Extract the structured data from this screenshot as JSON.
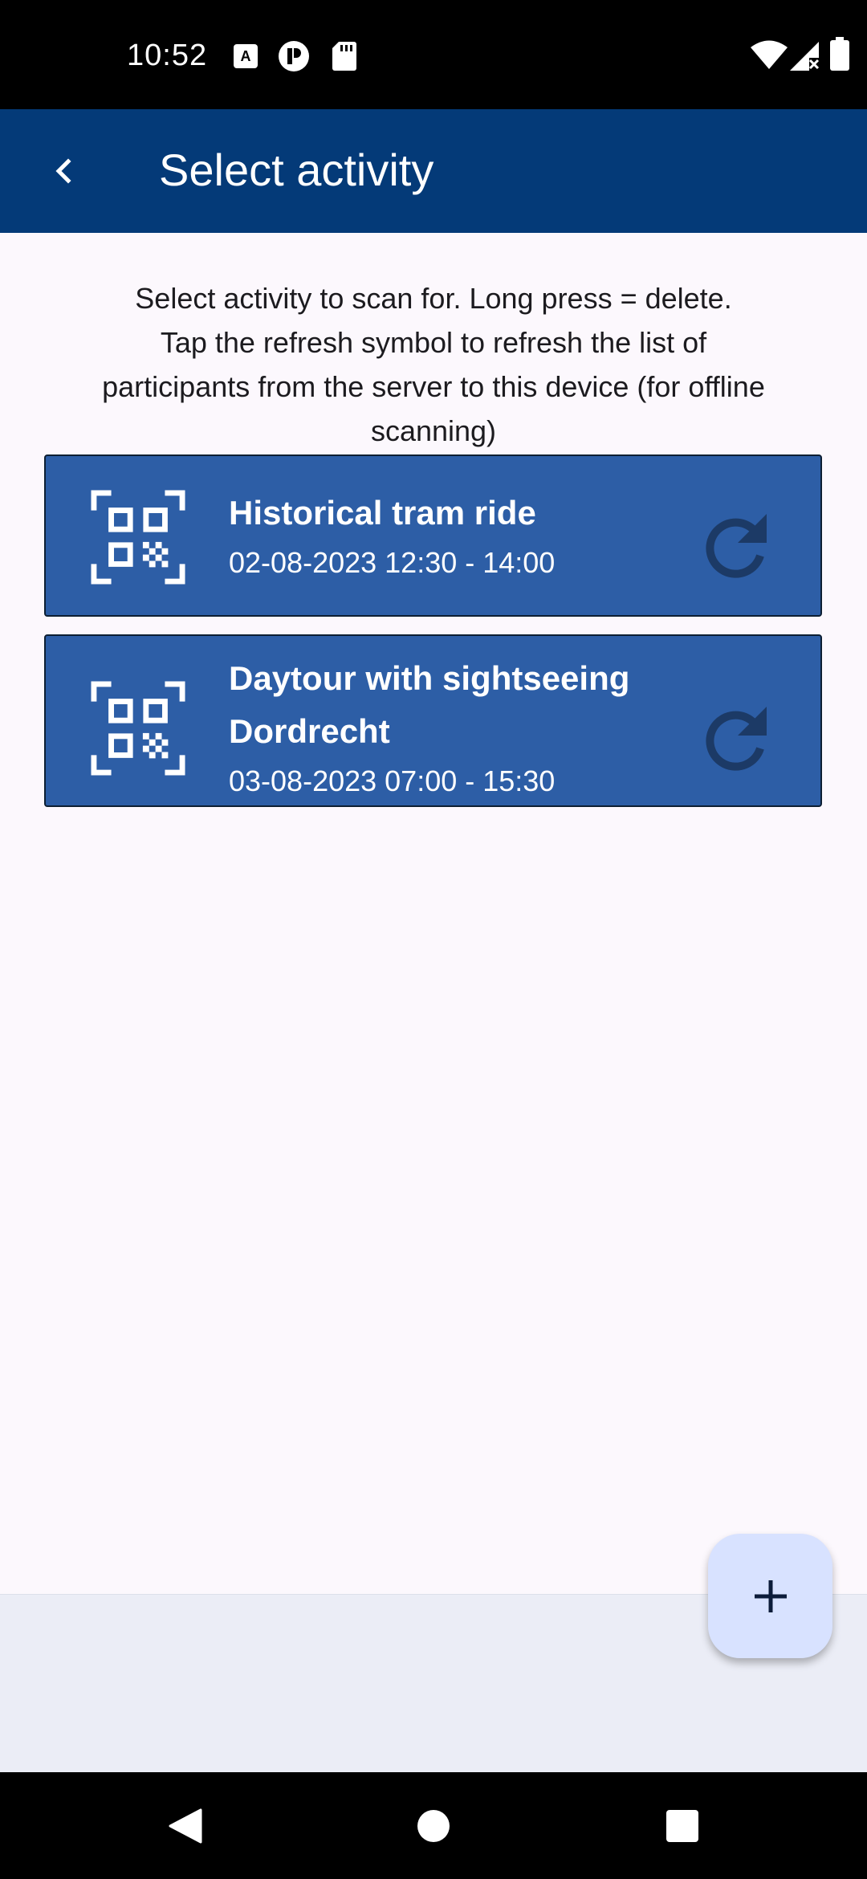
{
  "status_bar": {
    "time": "10:52",
    "icons": [
      "keyboard-a-icon",
      "notification-p-icon",
      "sd-card-icon",
      "wifi-icon",
      "signal-no-data-icon",
      "battery-icon"
    ]
  },
  "app_bar": {
    "back_icon": "chevron-left-icon",
    "title": "Select activity",
    "color": "#043a78"
  },
  "instructions": [
    "Select activity to scan for. Long press = delete.",
    "Tap the refresh symbol to refresh the list of",
    "participants from the server to this device (for offline",
    "scanning)"
  ],
  "activities": [
    {
      "title": "Historical tram ride",
      "datetime": "02-08-2023 12:30 - 14:00",
      "icon": "qr-code-scan-icon",
      "action_icon": "refresh-icon"
    },
    {
      "title": "Daytour with sightseeing Dordrecht",
      "datetime": "03-08-2023 07:00 - 15:30",
      "icon": "qr-code-scan-icon",
      "action_icon": "refresh-icon"
    }
  ],
  "fab": {
    "icon": "plus-icon",
    "color": "#d8e2ff"
  },
  "colors": {
    "card": "#2d5ea6",
    "background": "#fcf8fd",
    "refresh_icon": "#1c3a66"
  },
  "nav_bar": {
    "icons": [
      "back-triangle-icon",
      "home-circle-icon",
      "recents-square-icon"
    ]
  }
}
